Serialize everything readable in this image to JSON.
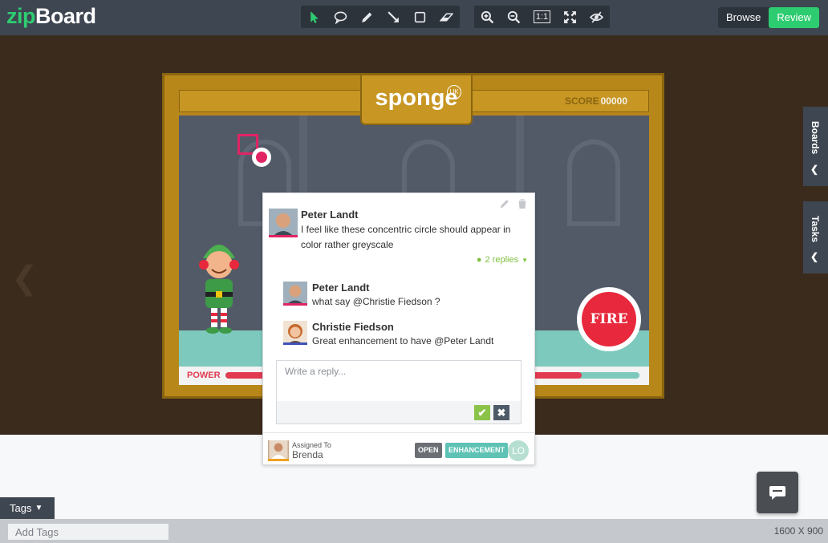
{
  "app": {
    "logo_prefix": "zip",
    "logo_suffix": "Board"
  },
  "toolbar": {
    "draw_tools": [
      "pointer-icon",
      "speech-bubble-icon",
      "pencil-icon",
      "arrow-icon",
      "rectangle-icon",
      "eraser-icon"
    ],
    "view_tools": [
      "zoom-in-icon",
      "zoom-out-icon",
      "actual-size-icon",
      "fit-screen-icon",
      "hide-annotations-icon"
    ],
    "actual_size_label": "1:1",
    "active_tool": "pointer-icon",
    "browse_label": "Browse",
    "review_label": "Review"
  },
  "game": {
    "brand": "sponge",
    "brand_badge": "UK",
    "score_label": "SCORE",
    "score_value": "00000",
    "power_label": "POWER",
    "power_level": 0.86,
    "fire_label": "FIRE"
  },
  "comment": {
    "author": "Peter Landt",
    "text": "I feel like these concentric circle should appear in color rather greyscale",
    "replies_label": "2 replies",
    "replies": [
      {
        "author": "Peter Landt",
        "text": "what say @Christie Fiedson ?"
      },
      {
        "author": "Christie Fiedson",
        "text": "Great enhancement to have @Peter Landt"
      }
    ],
    "reply_placeholder": "Write a reply...",
    "assigned_label": "Assigned To",
    "assigned_name": "Brenda",
    "status": "OPEN",
    "type": "ENHANCEMENT",
    "initials": "LO"
  },
  "side_tabs": {
    "boards": "Boards",
    "tasks": "Tasks"
  },
  "tags": {
    "toggle_label": "Tags",
    "placeholder": "Add Tags"
  },
  "canvas_size": "1600 X 900",
  "colors": {
    "accent_green": "#2ecc71",
    "topbar": "#3e4651",
    "marker": "#e02464",
    "fire_red": "#e8283c"
  }
}
